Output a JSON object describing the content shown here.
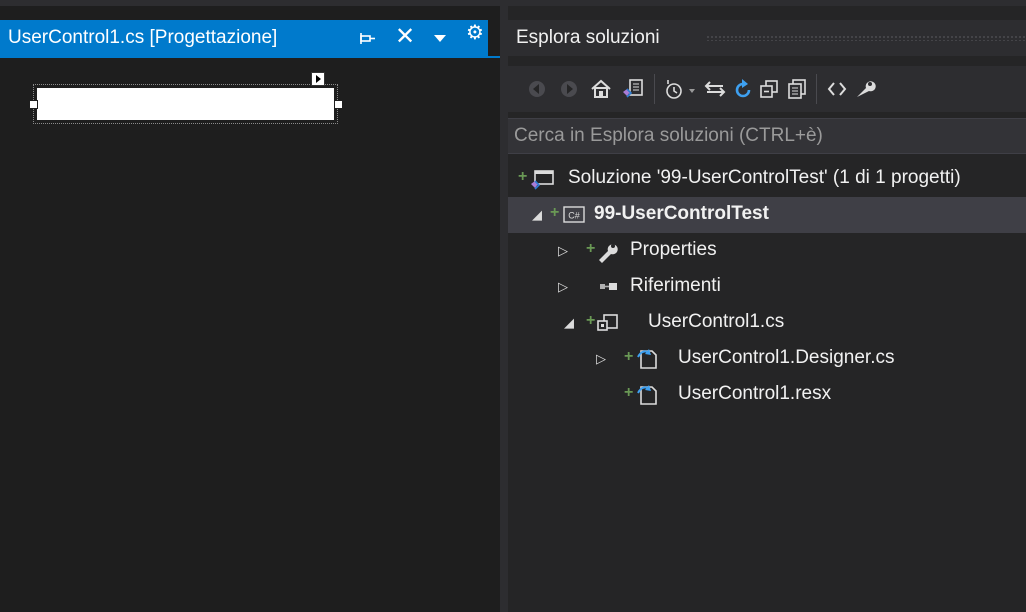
{
  "document": {
    "tab_title": "UserControl1.cs [Progettazione]",
    "close_glyph": "✕",
    "settings_glyph": "⚙"
  },
  "solution_explorer": {
    "title": "Esplora soluzioni",
    "search_placeholder": "Cerca in Esplora soluzioni (CTRL+è)",
    "toolbar_icons": [
      "back-icon",
      "forward-icon",
      "home-icon",
      "switch-views-icon",
      "pending-changes-filter-icon",
      "sync-with-active-document-icon",
      "refresh-icon",
      "collapse-all-icon",
      "show-all-files-icon",
      "view-code-icon",
      "properties-icon"
    ],
    "tree": {
      "solution": "Soluzione '99-UserControlTest' (1 di 1 progetti)",
      "project": "99-UserControlTest",
      "project_icon_text": "C#",
      "properties": "Properties",
      "references": "Riferimenti",
      "usercontrol": "UserControl1.cs",
      "designer": "UserControl1.Designer.cs",
      "resx": "UserControl1.resx"
    }
  },
  "colors": {
    "accent": "#007acc",
    "background": "#1e1e1e",
    "tool_window": "#252526",
    "selected_row": "#3f3f46",
    "plus_green": "#6a9955"
  }
}
